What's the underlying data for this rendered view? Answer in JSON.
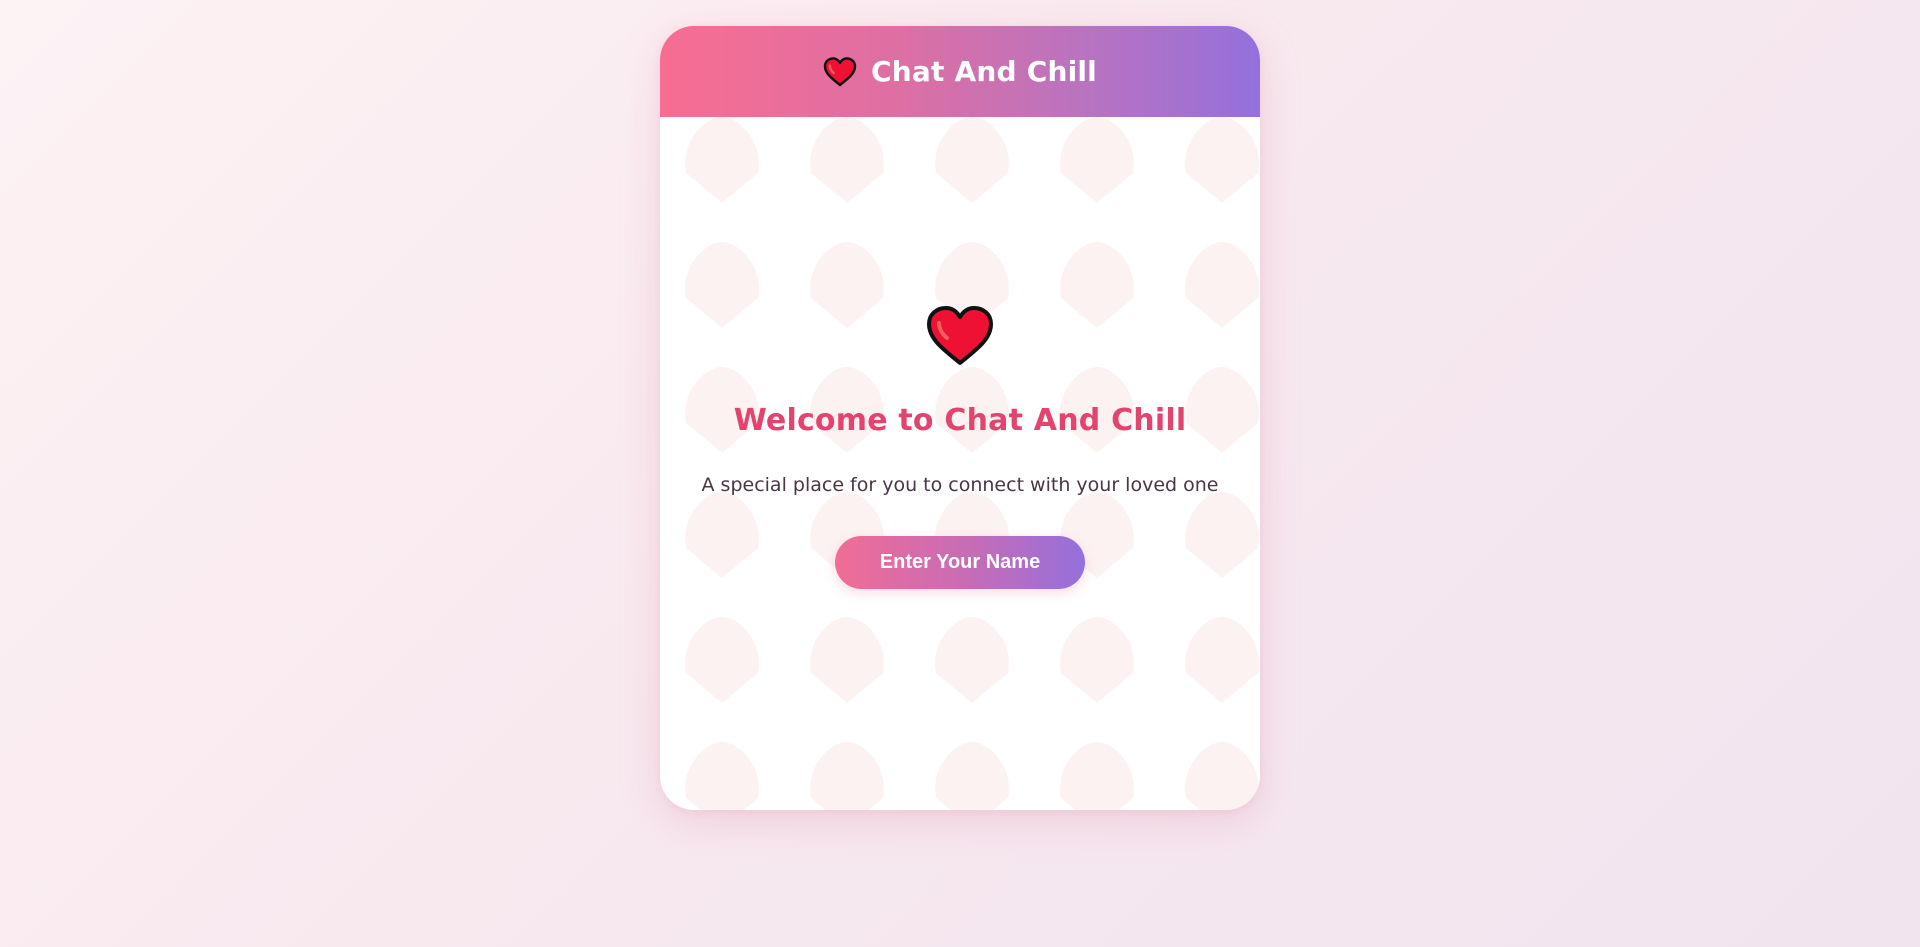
{
  "header": {
    "title": "Chat And Chill",
    "icon": "heart-icon"
  },
  "main": {
    "icon": "heart-icon",
    "title": "Welcome to Chat And Chill",
    "subtitle": "A special place for you to connect with your loved one",
    "enter_button_label": "Enter Your Name"
  },
  "colors": {
    "header_gradient_start": "#f86d91",
    "header_gradient_end": "#9470dc",
    "title_color": "#e2446e",
    "heart_fill": "#ee1133",
    "background": "#f8e9ef"
  }
}
